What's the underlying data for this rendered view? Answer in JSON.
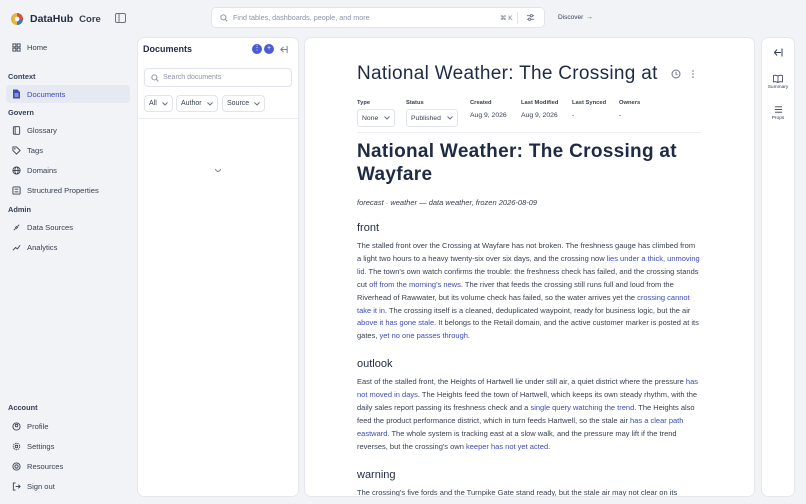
{
  "app": {
    "name": "DataHub",
    "edition": "Core"
  },
  "topbar": {
    "search_placeholder": "Find tables, dashboards, people, and more",
    "shortcut": "⌘ K",
    "discover_label": "Discover",
    "discover_arrow": "→"
  },
  "nav": {
    "home": "Home",
    "context_header": "Context",
    "documents": "Documents",
    "govern_header": "Govern",
    "glossary": "Glossary",
    "tags": "Tags",
    "domains": "Domains",
    "structured_properties": "Structured Properties",
    "admin_header": "Admin",
    "data_sources": "Data Sources",
    "analytics": "Analytics",
    "account_header": "Account",
    "profile": "Profile",
    "settings": "Settings",
    "resources": "Resources",
    "sign_out": "Sign out"
  },
  "docs_panel": {
    "title": "Documents",
    "search_placeholder": "Search documents",
    "filters": [
      "All",
      "Author",
      "Source"
    ]
  },
  "document": {
    "header_title": "National Weather: The Crossing at",
    "meta": {
      "type_label": "Type",
      "type_value": "None",
      "status_label": "Status",
      "status_value": "Published",
      "created_label": "Created",
      "created_value": "Aug 9, 2026",
      "modified_label": "Last Modified",
      "modified_value": "Aug 9, 2026",
      "synced_label": "Last Synced",
      "synced_value": "-",
      "owners_label": "Owners",
      "owners_value": "-"
    },
    "title": "National Weather: The Crossing at Wayfare",
    "subtitle": "forecast · weather — data weather, frozen 2026-08-09",
    "sections": [
      {
        "heading": "front",
        "parts": [
          {
            "t": "The stalled front over the Crossing at Wayfare has not broken. The freshness gauge has climbed from a light two hours to a heavy twenty-six over six days, and the crossing now "
          },
          {
            "t": "lies under a thick, unmoving lid",
            "link": true
          },
          {
            "t": ". The town's own watch confirms the trouble: the freshness check has failed, and the crossing stands cut "
          },
          {
            "t": "off from the morning's news",
            "link": true
          },
          {
            "t": ". The river that feeds the crossing still runs full and loud from the Riverhead of Rawwater, but its volume check has failed, so the water arrives yet the "
          },
          {
            "t": "crossing cannot take it in",
            "link": true
          },
          {
            "t": ". The crossing itself is a cleaned, deduplicated waypoint, ready for business logic, but the air "
          },
          {
            "t": "above it has gone stale",
            "link": true
          },
          {
            "t": ". It belongs to the Retail domain, and the active customer marker is posted at its gates, "
          },
          {
            "t": "yet no one passes through",
            "link": true
          },
          {
            "t": "."
          }
        ]
      },
      {
        "heading": "outlook",
        "parts": [
          {
            "t": "East of the stalled front, the Heights of Hartwell lie under still air, a quiet district where the pressure "
          },
          {
            "t": "has not moved in days",
            "link": true
          },
          {
            "t": ". The Heights feed the town of Hartwell, which keeps its own steady rhythm, with the daily sales report passing its freshness check and a "
          },
          {
            "t": "single query watching the trend",
            "link": true
          },
          {
            "t": ". The Heights also feed the product performance district, which in turn feeds Hartwell, so the stale air "
          },
          {
            "t": "has a clear path eastward",
            "link": true
          },
          {
            "t": ". The whole system is tracking east at a slow walk, and the pressure may lift if the trend reverses, but the crossing's own "
          },
          {
            "t": "keeper has not yet acted",
            "link": true
          },
          {
            "t": "."
          }
        ]
      },
      {
        "heading": "warning",
        "parts": [
          {
            "t": "The crossing's five fords and the Turnpike Gate stand ready, but the stale air may not clear on its"
          }
        ]
      }
    ]
  },
  "rail": {
    "summary": "Summary",
    "props": "Props"
  },
  "colors": {
    "accent": "#3b4bb8",
    "active_bg": "#e6e9f2",
    "badge": "#4a5bd4"
  }
}
